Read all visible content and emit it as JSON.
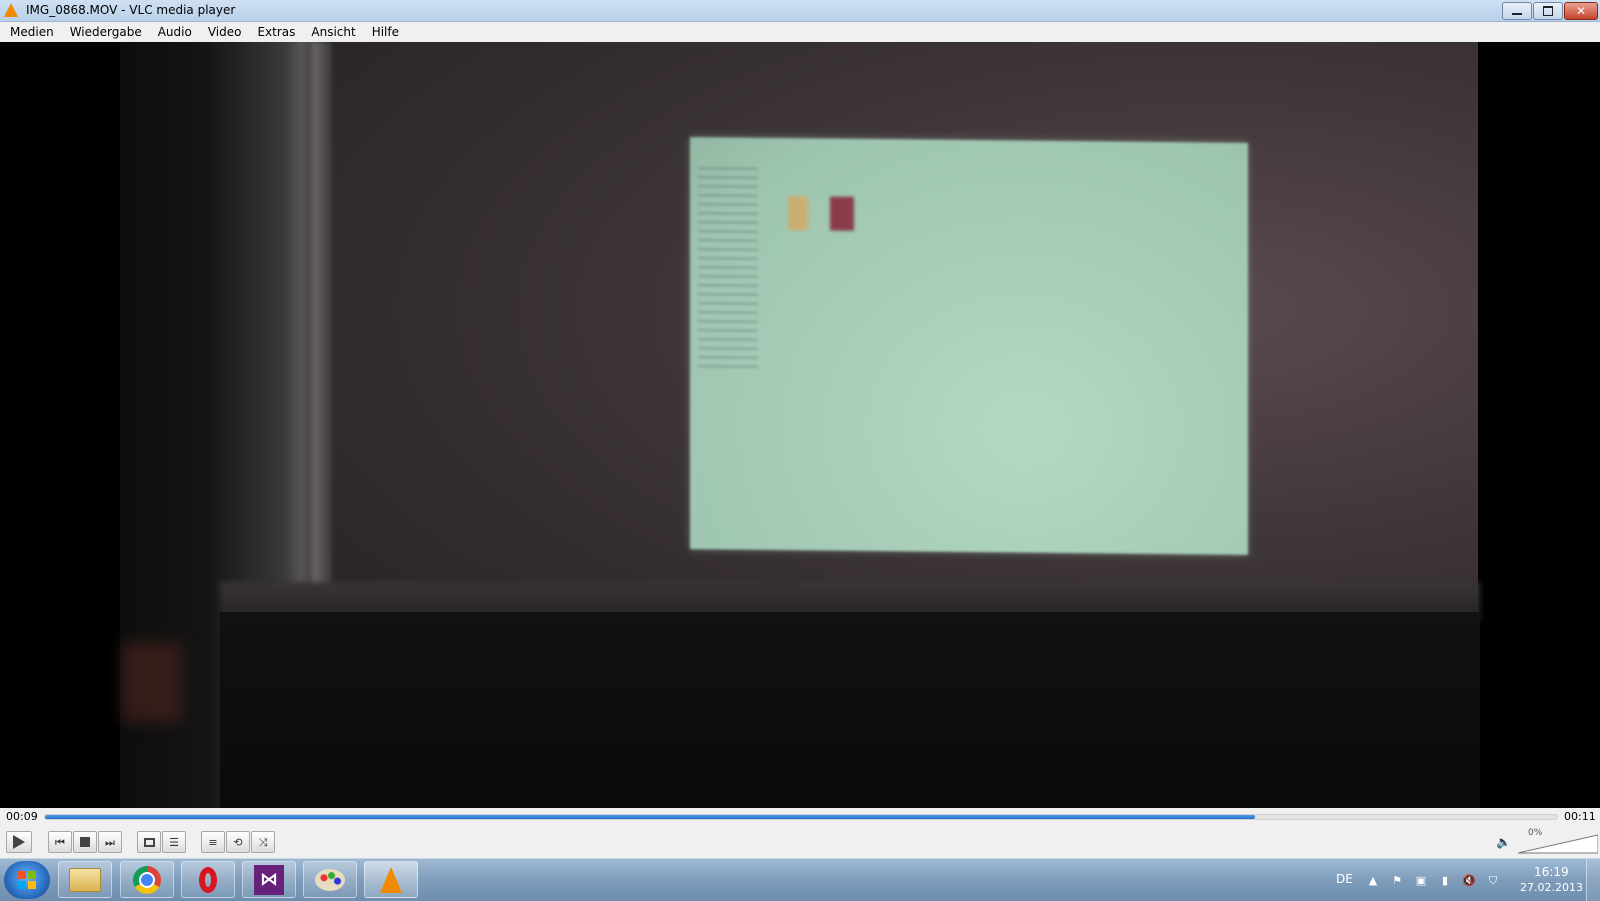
{
  "window": {
    "title": "IMG_0868.MOV - VLC media player",
    "buttons": [
      "minimize",
      "restore",
      "close"
    ]
  },
  "menu": {
    "items": [
      "Medien",
      "Wiedergabe",
      "Audio",
      "Video",
      "Extras",
      "Ansicht",
      "Hilfe"
    ]
  },
  "player": {
    "elapsed": "00:09",
    "total": "00:11",
    "progress_fraction": 0.8,
    "volume": "0%",
    "accent_color": "#2f86e0"
  },
  "controls": {
    "icons": [
      "play-icon",
      "previous-icon",
      "stop-icon",
      "next-icon",
      "fullscreen-icon",
      "extended-settings-icon",
      "playlist-icon",
      "loop-icon",
      "shuffle-icon",
      "volume-icon"
    ]
  },
  "taskbar": {
    "apps": [
      "explorer",
      "chrome",
      "opera",
      "visual-studio",
      "paint",
      "vlc"
    ],
    "active_app": "vlc",
    "language": "DE",
    "time": "16:19",
    "date": "27.02.2013"
  }
}
